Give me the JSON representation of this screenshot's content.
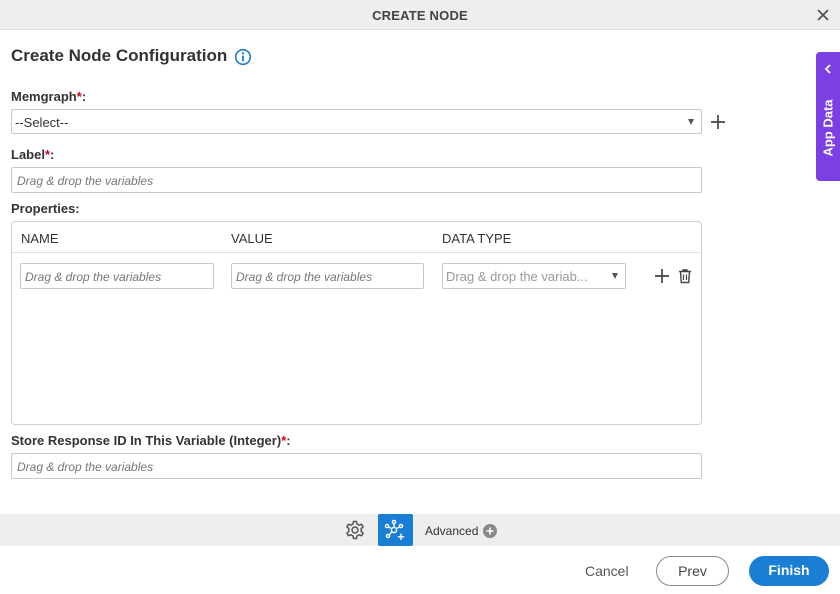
{
  "dialog": {
    "title": "CREATE NODE"
  },
  "heading": "Create Node Configuration",
  "memgraph": {
    "label": "Memgraph",
    "required_mark": "*",
    "colon": ":",
    "value": "--Select--"
  },
  "label_field": {
    "label": "Label",
    "required_mark": "*",
    "colon": ":",
    "placeholder": "Drag & drop the variables"
  },
  "properties": {
    "label": "Properties:",
    "columns": [
      "NAME",
      "VALUE",
      "DATA TYPE"
    ],
    "rows": [
      {
        "name_placeholder": "Drag & drop the variables",
        "value_placeholder": "Drag & drop the variables",
        "data_type_placeholder": "Drag & drop the variab..."
      }
    ]
  },
  "store_response": {
    "label": "Store Response ID In This Variable (Integer)",
    "required_mark": "*",
    "colon": ":",
    "placeholder": "Drag & drop the variables"
  },
  "side_panel": {
    "label": "App Data"
  },
  "toolbar": {
    "advanced_label": "Advanced"
  },
  "footer": {
    "cancel": "Cancel",
    "prev": "Prev",
    "finish": "Finish"
  },
  "colors": {
    "accent": "#1a7fd4",
    "side_tab": "#7b3fe4",
    "required": "#d0021b"
  }
}
